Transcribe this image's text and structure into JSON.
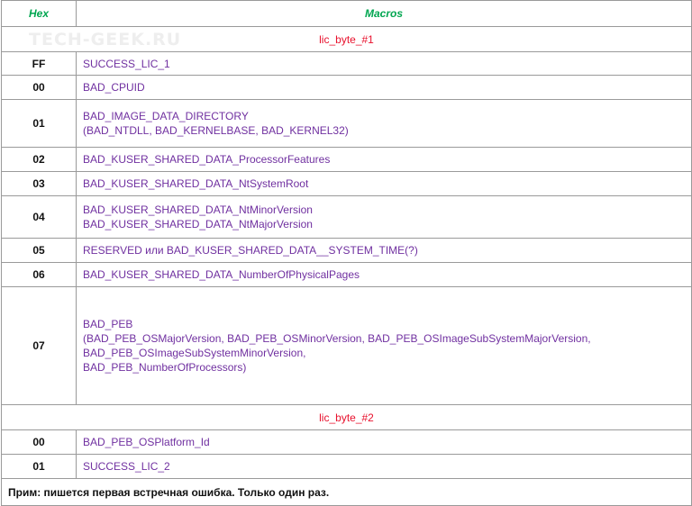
{
  "header": {
    "hex": "Hex",
    "macros": "Macros"
  },
  "watermark": "TECH-GEEK.RU",
  "sections": [
    {
      "title": "lic_byte_#1",
      "rows": [
        {
          "hex": "FF",
          "lines": [
            "SUCCESS_LIC_1"
          ]
        },
        {
          "hex": "00",
          "lines": [
            "BAD_CPUID"
          ]
        },
        {
          "hex": "01",
          "lines": [
            "BAD_IMAGE_DATA_DIRECTORY",
            "(BAD_NTDLL, BAD_KERNELBASE, BAD_KERNEL32)"
          ]
        },
        {
          "hex": "02",
          "lines": [
            "BAD_KUSER_SHARED_DATA_ProcessorFeatures"
          ]
        },
        {
          "hex": "03",
          "lines": [
            "BAD_KUSER_SHARED_DATA_NtSystemRoot"
          ]
        },
        {
          "hex": "04",
          "lines": [
            "BAD_KUSER_SHARED_DATA_NtMinorVersion",
            "BAD_KUSER_SHARED_DATA_NtMajorVersion"
          ]
        },
        {
          "hex": "05",
          "lines": [
            "RESERVED или BAD_KUSER_SHARED_DATA__SYSTEM_TIME(?)"
          ]
        },
        {
          "hex": "06",
          "lines": [
            "BAD_KUSER_SHARED_DATA_NumberOfPhysicalPages"
          ]
        },
        {
          "hex": "07",
          "lines": [
            "BAD_PEB",
            "(BAD_PEB_OSMajorVersion, BAD_PEB_OSMinorVersion, BAD_PEB_OSImageSubSystemMajorVersion,",
            "BAD_PEB_OSImageSubSystemMinorVersion,",
            "BAD_PEB_NumberOfProcessors)"
          ]
        }
      ]
    },
    {
      "title": "lic_byte_#2",
      "rows": [
        {
          "hex": "00",
          "lines": [
            "BAD_PEB_OSPlatform_Id"
          ]
        },
        {
          "hex": "01",
          "lines": [
            "SUCCESS_LIC_2"
          ]
        }
      ]
    }
  ],
  "note": "Прим: пишется первая встречная ошибка. Только один раз."
}
